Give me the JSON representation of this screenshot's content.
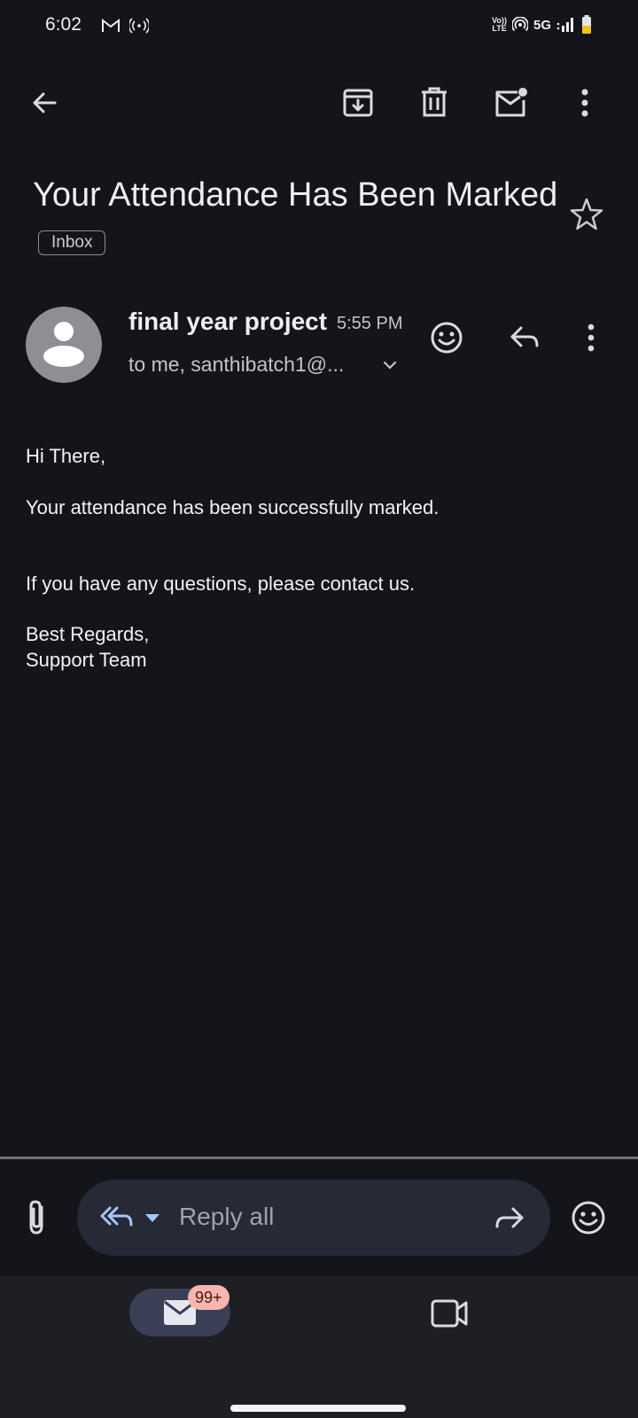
{
  "status_bar": {
    "time": "6:02",
    "volte_top": "Vo))",
    "volte_bottom": "LTE",
    "network": "5G",
    "icons": [
      "gmail-icon",
      "hotspot-icon",
      "volte-icon",
      "wifi-icon",
      "signal-icon",
      "battery-icon"
    ]
  },
  "toolbar": {
    "icons": [
      "back-arrow-icon",
      "archive-icon",
      "delete-icon",
      "mark-unread-icon",
      "more-vert-icon"
    ]
  },
  "email": {
    "subject": "Your Attendance Has Been Marked",
    "label": "Inbox",
    "starred": false,
    "sender": {
      "name": "final year project",
      "time": "5:55 PM",
      "recipients": "to me, santhibatch1@..."
    },
    "body": {
      "greeting": "Hi There,",
      "line1": "Your attendance has been successfully marked.",
      "line2": "If you have any questions, please contact us.",
      "signoff": "Best Regards,",
      "signature": "Support Team"
    }
  },
  "reply_bar": {
    "placeholder": "Reply all",
    "icons": [
      "attach-icon",
      "reply-all-icon",
      "dropdown-icon",
      "forward-icon",
      "emoji-icon"
    ]
  },
  "bottom_nav": {
    "mail_badge": "99+",
    "icons": [
      "mail-icon",
      "video-icon"
    ]
  },
  "colors": {
    "background": "#14151a",
    "reply_pill": "#262936",
    "nav_active": "#3a3f55",
    "badge": "#f5b6b0",
    "reply_all_icon": "#a8c7fa"
  }
}
